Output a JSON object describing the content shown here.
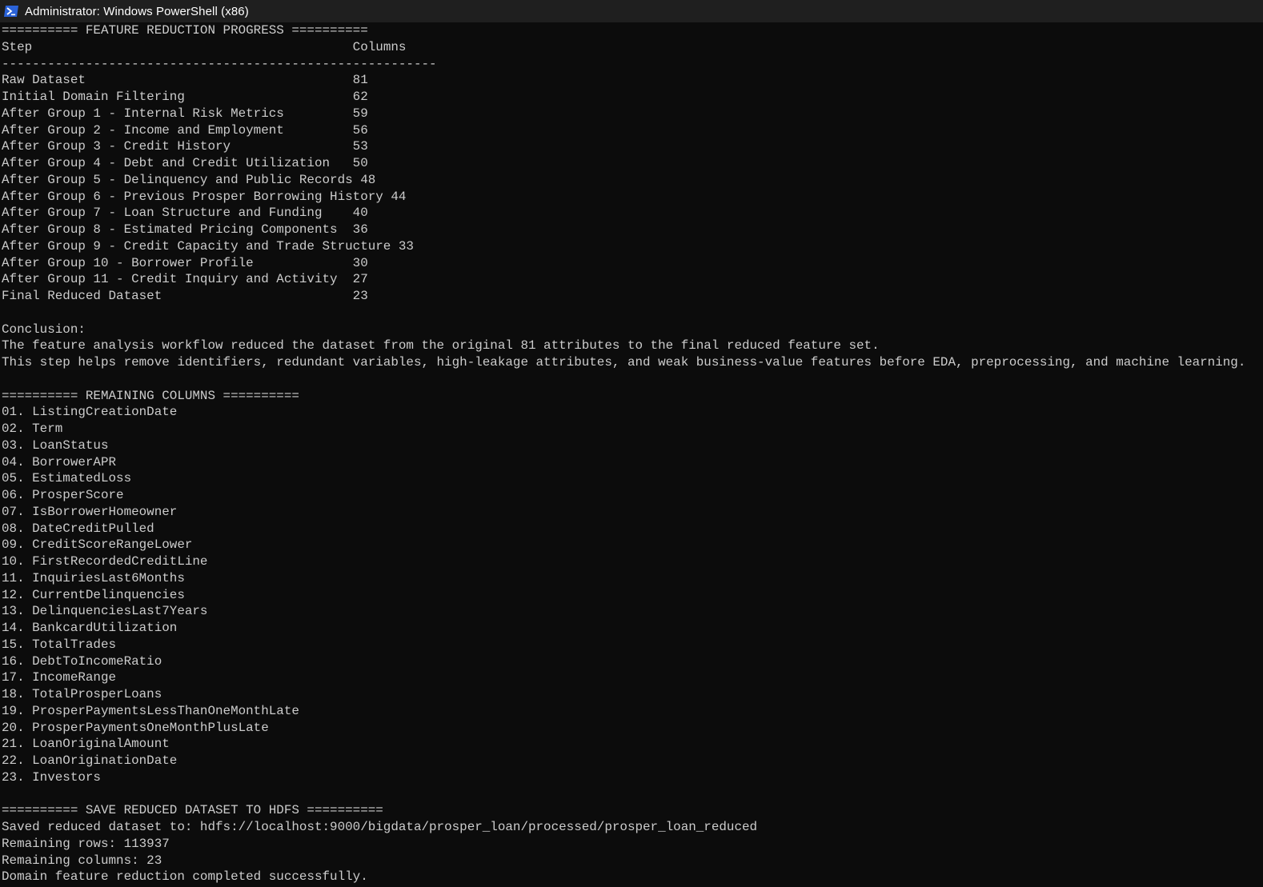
{
  "window": {
    "title": "Administrator: Windows PowerShell (x86)",
    "icon": "powershell-icon"
  },
  "colors": {
    "background": "#0c0c0c",
    "text": "#cccccc",
    "titlebar": "#1f1f1f",
    "icon_blue": "#2b63d9"
  },
  "progress": {
    "banner": "========== FEATURE REDUCTION PROGRESS ==========",
    "header_step": "Step",
    "header_columns": "Columns",
    "separator": "---------------------------------------------------------",
    "rows": [
      {
        "step": "Raw Dataset",
        "columns": "81"
      },
      {
        "step": "Initial Domain Filtering",
        "columns": "62"
      },
      {
        "step": "After Group 1 - Internal Risk Metrics",
        "columns": "59"
      },
      {
        "step": "After Group 2 - Income and Employment",
        "columns": "56"
      },
      {
        "step": "After Group 3 - Credit History",
        "columns": "53"
      },
      {
        "step": "After Group 4 - Debt and Credit Utilization",
        "columns": "50"
      },
      {
        "step": "After Group 5 - Delinquency and Public Records",
        "columns": "48"
      },
      {
        "step": "After Group 6 - Previous Prosper Borrowing History",
        "columns": "44"
      },
      {
        "step": "After Group 7 - Loan Structure and Funding",
        "columns": "40"
      },
      {
        "step": "After Group 8 - Estimated Pricing Components",
        "columns": "36"
      },
      {
        "step": "After Group 9 - Credit Capacity and Trade Structure",
        "columns": "33"
      },
      {
        "step": "After Group 10 - Borrower Profile",
        "columns": "30"
      },
      {
        "step": "After Group 11 - Credit Inquiry and Activity",
        "columns": "27"
      },
      {
        "step": "Final Reduced Dataset",
        "columns": "23"
      }
    ]
  },
  "conclusion": {
    "label": "Conclusion:",
    "line1": "The feature analysis workflow reduced the dataset from the original 81 attributes to the final reduced feature set.",
    "line2": "This step helps remove identifiers, redundant variables, high-leakage attributes, and weak business-value features before EDA, preprocessing, and machine learning."
  },
  "remaining": {
    "banner": "========== REMAINING COLUMNS ==========",
    "items": [
      "01. ListingCreationDate",
      "02. Term",
      "03. LoanStatus",
      "04. BorrowerAPR",
      "05. EstimatedLoss",
      "06. ProsperScore",
      "07. IsBorrowerHomeowner",
      "08. DateCreditPulled",
      "09. CreditScoreRangeLower",
      "10. FirstRecordedCreditLine",
      "11. InquiriesLast6Months",
      "12. CurrentDelinquencies",
      "13. DelinquenciesLast7Years",
      "14. BankcardUtilization",
      "15. TotalTrades",
      "16. DebtToIncomeRatio",
      "17. IncomeRange",
      "18. TotalProsperLoans",
      "19. ProsperPaymentsLessThanOneMonthLate",
      "20. ProsperPaymentsOneMonthPlusLate",
      "21. LoanOriginalAmount",
      "22. LoanOriginationDate",
      "23. Investors"
    ]
  },
  "save": {
    "banner": "========== SAVE REDUCED DATASET TO HDFS ==========",
    "saved_line": "Saved reduced dataset to: hdfs://localhost:9000/bigdata/prosper_loan/processed/prosper_loan_reduced",
    "rows_line": "Remaining rows: 113937",
    "columns_line": "Remaining columns: 23",
    "done_line": "Domain feature reduction completed successfully."
  }
}
